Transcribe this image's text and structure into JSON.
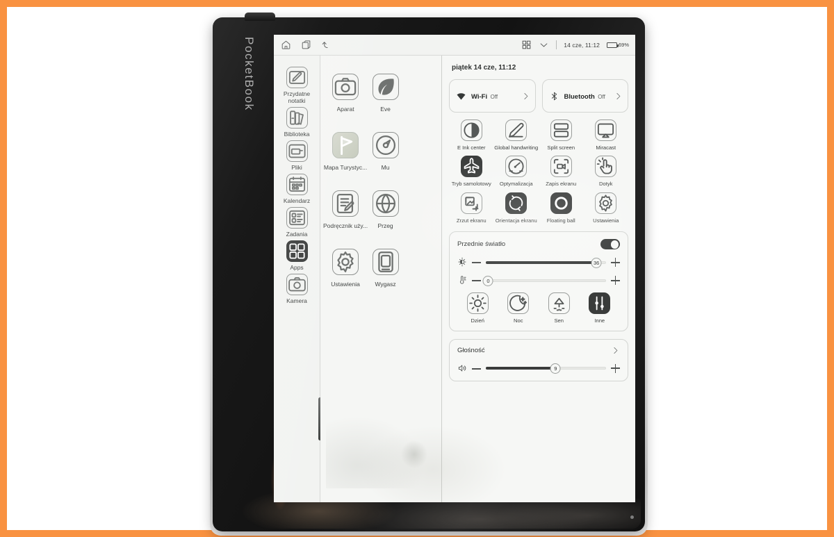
{
  "frame": {
    "accent_color": "#f99241"
  },
  "device": {
    "brand": "PocketBook",
    "power_button_name": "power-button"
  },
  "statusbar": {
    "home_icon": "home-icon",
    "recents_icon": "recents-icon",
    "back_icon": "back-icon",
    "grid_icon": "grid-view-icon",
    "chevron_icon": "chevron-down-icon",
    "time": "14 cze, 11:12",
    "battery_percent": "69%",
    "battery_level": 69
  },
  "sidebar": {
    "items": [
      {
        "label": "Przydatne notatki",
        "icon": "note-pen-icon",
        "active": false
      },
      {
        "label": "Biblioteka",
        "icon": "books-icon",
        "active": false
      },
      {
        "label": "Pliki",
        "icon": "folder-icon",
        "active": false
      },
      {
        "label": "Kalendarz",
        "icon": "calendar-icon",
        "active": false
      },
      {
        "label": "Zadania",
        "icon": "tasks-icon",
        "active": false
      },
      {
        "label": "Apps",
        "icon": "apps-grid-icon",
        "active": true
      },
      {
        "label": "Kamera",
        "icon": "camera-icon",
        "active": false
      }
    ]
  },
  "apps": {
    "items": [
      {
        "label": "Aparat",
        "icon": "camera-icon"
      },
      {
        "label": "Eve",
        "icon": "leaf-icon"
      },
      {
        "label": "",
        "icon": ""
      },
      {
        "label": "Mapa Turystyc...",
        "icon": "map-flag-icon"
      },
      {
        "label": "Mu",
        "icon": "music-icon"
      },
      {
        "label": "",
        "icon": ""
      },
      {
        "label": "Podręcznik uży...",
        "icon": "manual-pen-icon"
      },
      {
        "label": "Przeg",
        "icon": "browser-globe-icon"
      },
      {
        "label": "",
        "icon": ""
      },
      {
        "label": "Ustawienia",
        "icon": "gear-icon"
      },
      {
        "label": "Wygasz",
        "icon": "screensaver-icon"
      },
      {
        "label": "",
        "icon": ""
      }
    ]
  },
  "control_panel": {
    "date": "piątek 14 cze, 11:12",
    "connections": [
      {
        "name": "Wi-Fi",
        "state": "Off",
        "icon": "wifi-icon"
      },
      {
        "name": "Bluetooth",
        "state": "Off",
        "icon": "bluetooth-icon"
      }
    ],
    "toggles": [
      {
        "label": "E Ink center",
        "icon": "contrast-circle-icon",
        "active": false
      },
      {
        "label": "Global handwriting",
        "icon": "pencil-icon",
        "active": false
      },
      {
        "label": "Split screen",
        "icon": "split-screen-icon",
        "active": false
      },
      {
        "label": "Miracast",
        "icon": "cast-icon",
        "active": false
      },
      {
        "label": "Tryb samolotowy",
        "icon": "airplane-icon",
        "active": true
      },
      {
        "label": "Optymalizacja",
        "icon": "speedometer-icon",
        "active": false
      },
      {
        "label": "Zapis ekranu",
        "icon": "screen-record-icon",
        "active": false
      },
      {
        "label": "Dotyk",
        "icon": "touch-hand-icon",
        "active": false
      },
      {
        "label": "Zrzut ekranu",
        "icon": "screenshot-icon",
        "active": false
      },
      {
        "label": "Orientacja ekranu",
        "icon": "rotate-screen-icon",
        "active": true
      },
      {
        "label": "Floating ball",
        "icon": "floating-ball-icon",
        "active": true
      },
      {
        "label": "Ustawienia",
        "icon": "gear-icon",
        "active": false
      }
    ],
    "front_light": {
      "title": "Przednie światło",
      "enabled": true,
      "brightness": {
        "icon": "brightness-icon",
        "value": 36,
        "percent": 92
      },
      "warmth": {
        "icon": "warmth-thermometer-icon",
        "value": 0,
        "percent": 2
      },
      "presets": [
        {
          "label": "Dzień",
          "icon": "sun-icon",
          "active": false
        },
        {
          "label": "Noc",
          "icon": "moon-icon",
          "active": false
        },
        {
          "label": "Sen",
          "icon": "sleep-lamp-icon",
          "active": false
        },
        {
          "label": "Inne",
          "icon": "sliders-icon",
          "active": true
        }
      ]
    },
    "volume": {
      "title": "Głośność",
      "icon": "speaker-icon",
      "value": 9,
      "percent": 58,
      "chevron_icon": "chevron-right-icon"
    }
  }
}
